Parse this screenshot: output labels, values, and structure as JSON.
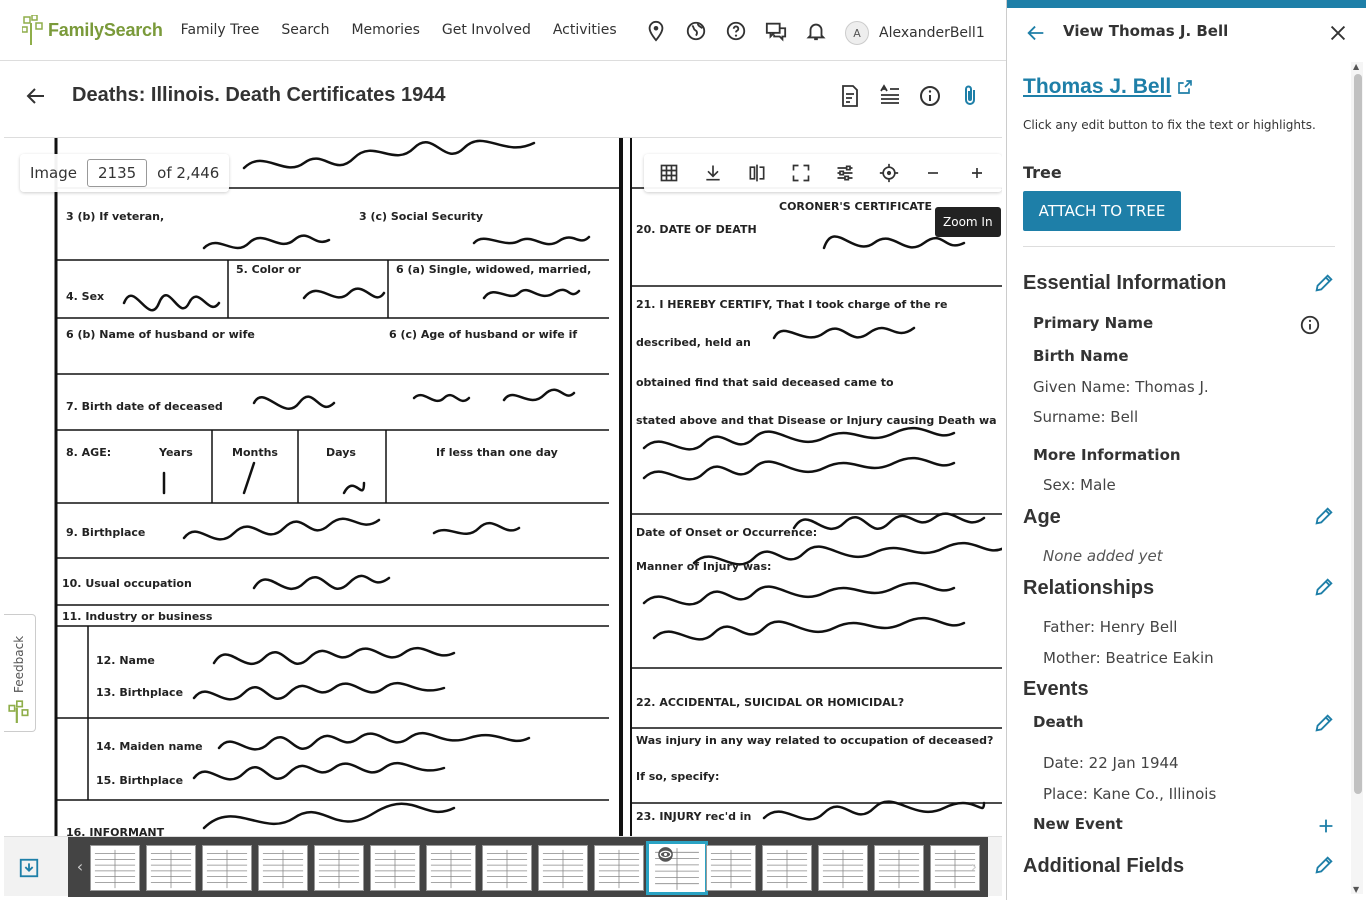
{
  "nav": {
    "logo_text": "FamilySearch",
    "links": [
      "Family Tree",
      "Search",
      "Memories",
      "Get Involved",
      "Activities"
    ],
    "icons": [
      "location-pin-icon",
      "globe-icon",
      "help-icon",
      "chat-icon",
      "bell-icon"
    ],
    "user_initial": "A",
    "user_name": "AlexanderBell1"
  },
  "header": {
    "title": "Deaths: Illinois. Death Certificates 1944",
    "icons": [
      "document-edit-icon",
      "text-lines-icon",
      "info-icon",
      "paperclip-icon"
    ]
  },
  "viewer": {
    "image_label": "Image",
    "image_number": "2135",
    "image_total": "of 2,446",
    "tooltip": "Zoom In",
    "tools": [
      "grid-icon",
      "download-icon",
      "compare-icon",
      "fullscreen-icon",
      "adjust-icon",
      "target-icon",
      "zoom-out-icon",
      "zoom-in-icon"
    ],
    "feedback_label": "Feedback",
    "selected_thumb": 10
  },
  "panel": {
    "title": "View Thomas J. Bell",
    "person_name": "Thomas J. Bell",
    "hint": "Click any edit button to fix the text or highlights.",
    "tree_heading": "Tree",
    "attach_label": "ATTACH TO TREE",
    "essential": {
      "heading": "Essential Information",
      "primary_name": "Primary Name",
      "birth_name": "Birth Name",
      "given_name": "Given Name: Thomas J.",
      "surname": "Surname: Bell",
      "more_info": "More Information",
      "sex": "Sex: Male"
    },
    "age": {
      "heading": "Age",
      "empty": "None added yet"
    },
    "relationships": {
      "heading": "Relationships",
      "father": "Father: Henry Bell",
      "mother": "Mother: Beatrice Eakin"
    },
    "events": {
      "heading": "Events",
      "death": "Death",
      "date": "Date: 22 Jan 1944",
      "place": "Place: Kane Co., Illinois",
      "new_event": "New Event"
    },
    "additional": {
      "heading": "Additional Fields"
    }
  },
  "colors": {
    "accent": "#1e7fa8",
    "logo_green": "#7a9a3a",
    "selected_thumb": "#2aa3c4"
  }
}
